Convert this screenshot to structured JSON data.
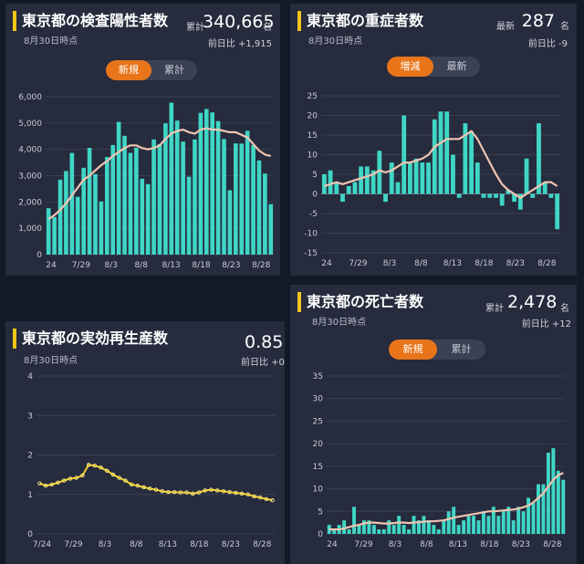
{
  "panels": {
    "cases": {
      "title": "東京都の検査陽性者数",
      "date": "8月30日時点",
      "label": "累計",
      "value": "340,665",
      "unit": "名",
      "diff": "前日比 +1,915",
      "tabs": [
        "新規",
        "累計"
      ]
    },
    "severe": {
      "title": "東京都の重症者数",
      "date": "8月30日時点",
      "label": "最新",
      "value": "287",
      "unit": "名",
      "diff": "前日比 -9",
      "tabs": [
        "増減",
        "最新"
      ]
    },
    "rt": {
      "title": "東京都の実効再生産数",
      "date": "8月30日時点",
      "value": "0.85",
      "diff": "前日比 +0"
    },
    "deaths": {
      "title": "東京都の死亡者数",
      "date": "8月30日時点",
      "label": "累計",
      "value": "2,478",
      "unit": "名",
      "diff": "前日比 +12",
      "tabs": [
        "新規",
        "累計"
      ]
    }
  },
  "colors": {
    "bar": "#3fd6c6",
    "line": "#f0c4b0",
    "rt_line": "#f5d020",
    "panel": "#262b3d",
    "accent": "#e8751a"
  },
  "chart_data": [
    {
      "id": "cases",
      "type": "bar",
      "ylim": [
        0,
        6000
      ],
      "yticks": [
        0,
        1000,
        2000,
        3000,
        4000,
        5000,
        6000
      ],
      "ytick_labels": [
        "0",
        "1,000",
        "2,000",
        "3,000",
        "4,000",
        "5,000",
        "6,000"
      ],
      "xtick_labels": [
        "24",
        "7/29",
        "8/3",
        "8/8",
        "8/13",
        "8/18",
        "8/23",
        "8/28"
      ],
      "values": [
        1763,
        1429,
        2848,
        3177,
        3865,
        2195,
        3300,
        4058,
        3058,
        2017,
        3709,
        4166,
        5042,
        4515,
        3865,
        4066,
        2884,
        2679,
        4377,
        4200,
        4989,
        5773,
        5094,
        4295,
        2962,
        4377,
        5386,
        5534,
        5405,
        5074,
        4392,
        2447,
        4228,
        4220,
        4704,
        4163,
        3581,
        3081,
        1915
      ],
      "moving_avg": [
        1350,
        1500,
        1700,
        1950,
        2250,
        2550,
        2850,
        3000,
        3200,
        3400,
        3550,
        3750,
        3900,
        4050,
        4150,
        4150,
        4050,
        4000,
        4050,
        4150,
        4400,
        4600,
        4700,
        4750,
        4650,
        4600,
        4750,
        4800,
        4750,
        4750,
        4700,
        4650,
        4650,
        4550,
        4450,
        4200,
        3950,
        3800,
        3750
      ]
    },
    {
      "id": "severe",
      "type": "bar",
      "ylim": [
        -15,
        25
      ],
      "yticks": [
        -15,
        -10,
        -5,
        0,
        5,
        10,
        15,
        20,
        25
      ],
      "ytick_labels": [
        "-15",
        "-10",
        "-5",
        "0",
        "5",
        "10",
        "15",
        "20",
        "25"
      ],
      "xtick_labels": [
        "24",
        "7/29",
        "8/3",
        "8/8",
        "8/13",
        "8/18",
        "8/23",
        "8/28"
      ],
      "values": [
        5,
        6,
        3,
        -2,
        2,
        3,
        7,
        7,
        6,
        11,
        -2,
        8,
        3,
        20,
        8,
        9,
        8,
        8,
        19,
        21,
        21,
        10,
        -1,
        18,
        16,
        8,
        -1,
        -1,
        -1,
        -3,
        1,
        -2,
        -4,
        9,
        -1,
        18,
        3,
        -1,
        -9
      ],
      "moving_avg": [
        2,
        2.5,
        3,
        2.5,
        3,
        3.5,
        4,
        4.5,
        5,
        6,
        5.5,
        6,
        7,
        8,
        8,
        8.5,
        9,
        10,
        12,
        13,
        14,
        14,
        14,
        15,
        16,
        14,
        11,
        8,
        5,
        2.5,
        1,
        0,
        -1,
        0,
        1,
        2,
        3,
        3,
        2
      ]
    },
    {
      "id": "rt",
      "type": "line",
      "ylim": [
        0,
        4
      ],
      "yticks": [
        0,
        1,
        2,
        3,
        4
      ],
      "ytick_labels": [
        "0",
        "1",
        "2",
        "3",
        "4"
      ],
      "xtick_labels": [
        "7/24",
        "7/29",
        "8/3",
        "8/8",
        "8/13",
        "8/18",
        "8/23",
        "8/28"
      ],
      "values": [
        1.28,
        1.22,
        1.25,
        1.3,
        1.35,
        1.4,
        1.42,
        1.48,
        1.75,
        1.73,
        1.68,
        1.6,
        1.5,
        1.42,
        1.35,
        1.25,
        1.22,
        1.18,
        1.15,
        1.12,
        1.08,
        1.06,
        1.06,
        1.05,
        1.05,
        1.02,
        1.05,
        1.1,
        1.12,
        1.1,
        1.08,
        1.06,
        1.04,
        1.02,
        1.0,
        0.95,
        0.92,
        0.88,
        0.85
      ]
    },
    {
      "id": "deaths",
      "type": "bar",
      "ylim": [
        0,
        35
      ],
      "yticks": [
        0,
        5,
        10,
        15,
        20,
        25,
        30,
        35
      ],
      "ytick_labels": [
        "0",
        "5",
        "10",
        "15",
        "20",
        "25",
        "30",
        "35"
      ],
      "xtick_labels": [
        "24",
        "7/29",
        "8/3",
        "8/8",
        "8/13",
        "8/18",
        "8/23",
        "8/28"
      ],
      "values": [
        2,
        1,
        2,
        3,
        1,
        6,
        2,
        3,
        3,
        2,
        1,
        1,
        3,
        2,
        4,
        2,
        1,
        4,
        3,
        4,
        3,
        2,
        1,
        3,
        5,
        6,
        2,
        3,
        4,
        4,
        3,
        5,
        4,
        6,
        4,
        5,
        6,
        3,
        6,
        5,
        8,
        7,
        11,
        11,
        18,
        19,
        14,
        12
      ],
      "moving_avg": [
        1,
        1,
        1,
        1.2,
        1.5,
        1.8,
        2,
        2.3,
        2.5,
        2.5,
        2.4,
        2.3,
        2.3,
        2.4,
        2.5,
        2.5,
        2.4,
        2.5,
        2.6,
        2.7,
        2.8,
        2.8,
        2.9,
        3,
        3.3,
        3.6,
        3.8,
        4,
        4.2,
        4.4,
        4.6,
        4.8,
        5,
        5,
        5.1,
        5.2,
        5.3,
        5.4,
        5.6,
        5.9,
        6.3,
        7,
        8,
        9,
        10.5,
        12,
        13,
        13.5
      ]
    }
  ]
}
